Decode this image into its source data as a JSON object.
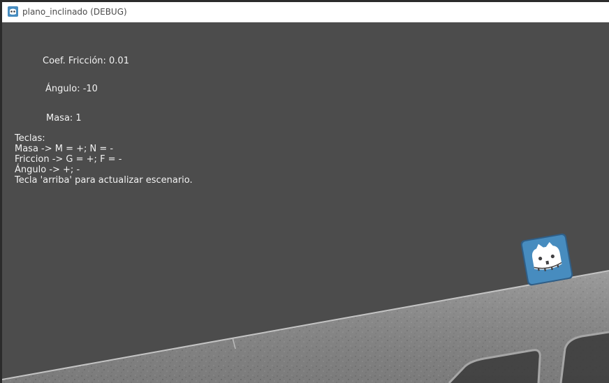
{
  "window": {
    "title": "plano_inclinado (DEBUG)",
    "app_icon": "godot-icon"
  },
  "hud": {
    "friction": "Coef. Fricción: 0.01",
    "angle": "Ángulo: -10",
    "mass": "Masa: 1"
  },
  "keys": {
    "heading": "Teclas:",
    "lines": [
      "Masa -> M = +; N = -",
      "Friccion -> G = +; F = -",
      "Ángulo -> +; -",
      "Tecla 'arriba' para actualizar escenario."
    ]
  },
  "scene": {
    "background_color": "#4c4c4c",
    "block_icon": "godot-icon",
    "block_color": "#478cbf",
    "ramp_color": "#8a8a8a",
    "ramp_icon": "concrete-ramp"
  }
}
